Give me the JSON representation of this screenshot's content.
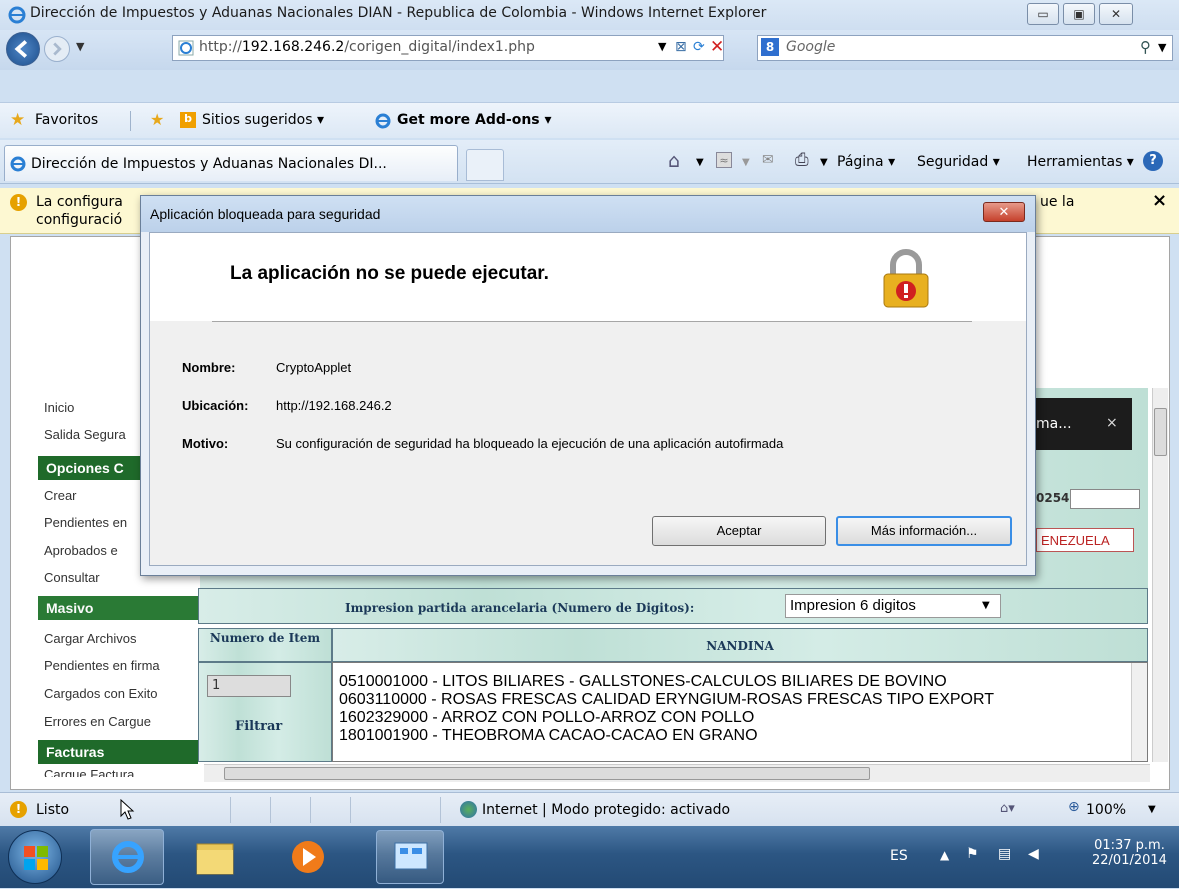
{
  "window": {
    "title": "Dirección de Impuestos y Aduanas Nacionales DIAN - Republica de Colombia - Windows Internet Explorer",
    "controls": {
      "minimize": "▭",
      "maximize": "▣",
      "close": "✕"
    }
  },
  "address": {
    "url_prefix": "http://",
    "url_host": "192.168.246.2",
    "url_path": "/corigen_digital/index1.php",
    "search_placeholder": "Google"
  },
  "favorites_bar": {
    "favorites": "Favoritos",
    "suggested": "Sitios sugeridos ▾",
    "addons": "Get more Add-ons ▾"
  },
  "tabs": {
    "active_tab": "Dirección de Impuestos y Aduanas Nacionales DI...",
    "commands": {
      "page": "Página ▾",
      "security": "Seguridad ▾",
      "tools": "Herramientas ▾"
    }
  },
  "infobar": {
    "line1": "La configura",
    "line2": "configuració",
    "right": "ue la",
    "close": "×"
  },
  "sidebar": {
    "items": [
      "Inicio",
      "Salida Segura",
      "Crear",
      "Pendientes en",
      "Aprobados e",
      "Consultar",
      "Cargar Archivos",
      "Pendientes en firma",
      "Cargados con Exito",
      "Errores en Cargue",
      "Cargue Factura"
    ],
    "headings": [
      "Opciones C",
      "Masivo",
      "Facturas"
    ]
  },
  "page": {
    "notice_text": "ma...",
    "notice_close": "×",
    "code_fragment": "0254",
    "country_fragment": "ENEZUELA",
    "impresion_label": "Impresion partida arancelaria (Numero de Digitos):",
    "impresion_value": "Impresion 6 digitos",
    "col_item": "Numero de Item",
    "col_nandina": "NANDINA",
    "item_value": "1",
    "filter": "Filtrar",
    "nandina_options": [
      "0510001000 - LITOS BILIARES - GALLSTONES-CALCULOS BILIARES DE BOVINO",
      "0603110000 - ROSAS FRESCAS CALIDAD ERYNGIUM-ROSAS FRESCAS TIPO EXPORT",
      "1602329000 - ARROZ CON POLLO-ARROZ CON POLLO",
      "1801001900 - THEOBROMA CACAO-CACAO EN GRANO"
    ]
  },
  "dialog": {
    "title": "Aplicación bloqueada para seguridad",
    "heading": "La aplicación no se puede ejecutar.",
    "fields": [
      {
        "label": "Nombre:",
        "value": "CryptoApplet"
      },
      {
        "label": "Ubicación:",
        "value": "http://192.168.246.2"
      },
      {
        "label": "Motivo:",
        "value": "Su configuración de seguridad ha bloqueado la ejecución de una aplicación autofirmada"
      }
    ],
    "ok_button": "Aceptar",
    "more_button": "Más información...",
    "close": "✕"
  },
  "statusbar": {
    "status": "Listo",
    "zone": "Internet | Modo protegido: activado",
    "zoom": "100%"
  },
  "taskbar": {
    "language": "ES",
    "time": "01:37 p.m.",
    "date": "22/01/2014"
  }
}
